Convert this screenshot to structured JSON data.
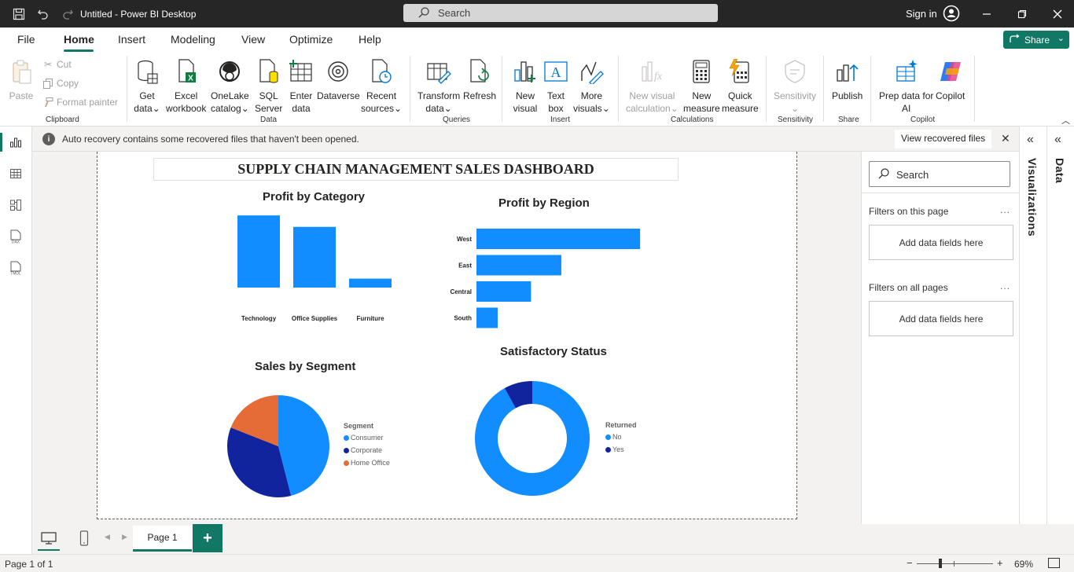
{
  "titlebar": {
    "title": "Untitled - Power BI Desktop",
    "search_placeholder": "Search",
    "sign_in": "Sign in"
  },
  "menu": {
    "tabs": [
      {
        "label": "File"
      },
      {
        "label": "Home"
      },
      {
        "label": "Insert"
      },
      {
        "label": "Modeling"
      },
      {
        "label": "View"
      },
      {
        "label": "Optimize"
      },
      {
        "label": "Help"
      }
    ],
    "active_tab": "Home",
    "share_label": "Share"
  },
  "ribbon": {
    "clipboard": {
      "paste": "Paste",
      "cut": "Cut",
      "copy": "Copy",
      "format_painter": "Format painter",
      "group": "Clipboard"
    },
    "data": {
      "get_data": [
        "Get",
        "data"
      ],
      "excel": [
        "Excel",
        "workbook"
      ],
      "onelake": [
        "OneLake",
        "catalog"
      ],
      "sql": [
        "SQL",
        "Server"
      ],
      "enter": [
        "Enter",
        "data"
      ],
      "dataverse": "Dataverse",
      "recent": [
        "Recent",
        "sources"
      ],
      "group": "Data"
    },
    "queries": {
      "transform": [
        "Transform",
        "data"
      ],
      "refresh": "Refresh",
      "group": "Queries"
    },
    "insert": {
      "new_visual": [
        "New",
        "visual"
      ],
      "text_box": [
        "Text",
        "box"
      ],
      "more_visuals": [
        "More",
        "visuals"
      ],
      "group": "Insert"
    },
    "calculations": {
      "new_visual_calc": [
        "New visual",
        "calculation"
      ],
      "new_measure": [
        "New",
        "measure"
      ],
      "quick_measure": [
        "Quick",
        "measure"
      ],
      "group": "Calculations"
    },
    "sensitivity": {
      "label": "Sensitivity",
      "group": "Sensitivity"
    },
    "share": {
      "publish": "Publish",
      "group": "Share"
    },
    "copilot": {
      "prep": [
        "Prep data for",
        "AI"
      ],
      "copilot": "Copilot",
      "group": "Copilot"
    }
  },
  "infobar": {
    "message": "Auto recovery contains some recovered files that haven't been opened.",
    "button": "View recovered files"
  },
  "dashboard": {
    "title": "SUPPLY CHAIN MANAGEMENT SALES DASHBOARD",
    "colors": {
      "primary": "#118DFF",
      "dark_blue": "#12239E",
      "orange": "#E66C37"
    }
  },
  "chart_data": [
    {
      "type": "bar",
      "title": "Profit by Category",
      "categories": [
        "Technology",
        "Office Supplies",
        "Furniture"
      ],
      "values": [
        145000,
        122000,
        18000
      ],
      "ylim": [
        0,
        150000
      ],
      "xlabel": "",
      "ylabel": "",
      "grid": false
    },
    {
      "type": "bar",
      "orientation": "horizontal",
      "title": "Profit by Region",
      "categories": [
        "West",
        "East",
        "Central",
        "South"
      ],
      "values": [
        108000,
        56000,
        36000,
        14000
      ],
      "xlim": [
        0,
        110000
      ],
      "xlabel": "",
      "ylabel": "",
      "grid": false
    },
    {
      "type": "pie",
      "title": "Sales by Segment",
      "legend_title": "Segment",
      "legend_position": "right",
      "labels": [
        "Consumer",
        "Corporate",
        "Home Office"
      ],
      "values": [
        46,
        35,
        19
      ],
      "colors": [
        "#118DFF",
        "#12239E",
        "#E66C37"
      ]
    },
    {
      "type": "pie",
      "subtype": "donut",
      "title": "Satisfactory Status",
      "legend_title": "Returned",
      "legend_position": "right",
      "labels": [
        "No",
        "Yes"
      ],
      "values": [
        92,
        8
      ],
      "colors": [
        "#118DFF",
        "#12239E"
      ]
    }
  ],
  "filters": {
    "search_placeholder": "Search",
    "this_page": "Filters on this page",
    "all_pages": "Filters on all pages",
    "add_fields": "Add data fields here",
    "more": "..."
  },
  "side_panes": {
    "visualizations": "Visualizations",
    "data": "Data"
  },
  "pages": {
    "current": "Page 1",
    "status": "Page 1 of 1"
  },
  "zoom": {
    "label": "69%",
    "value_percent": 69
  }
}
